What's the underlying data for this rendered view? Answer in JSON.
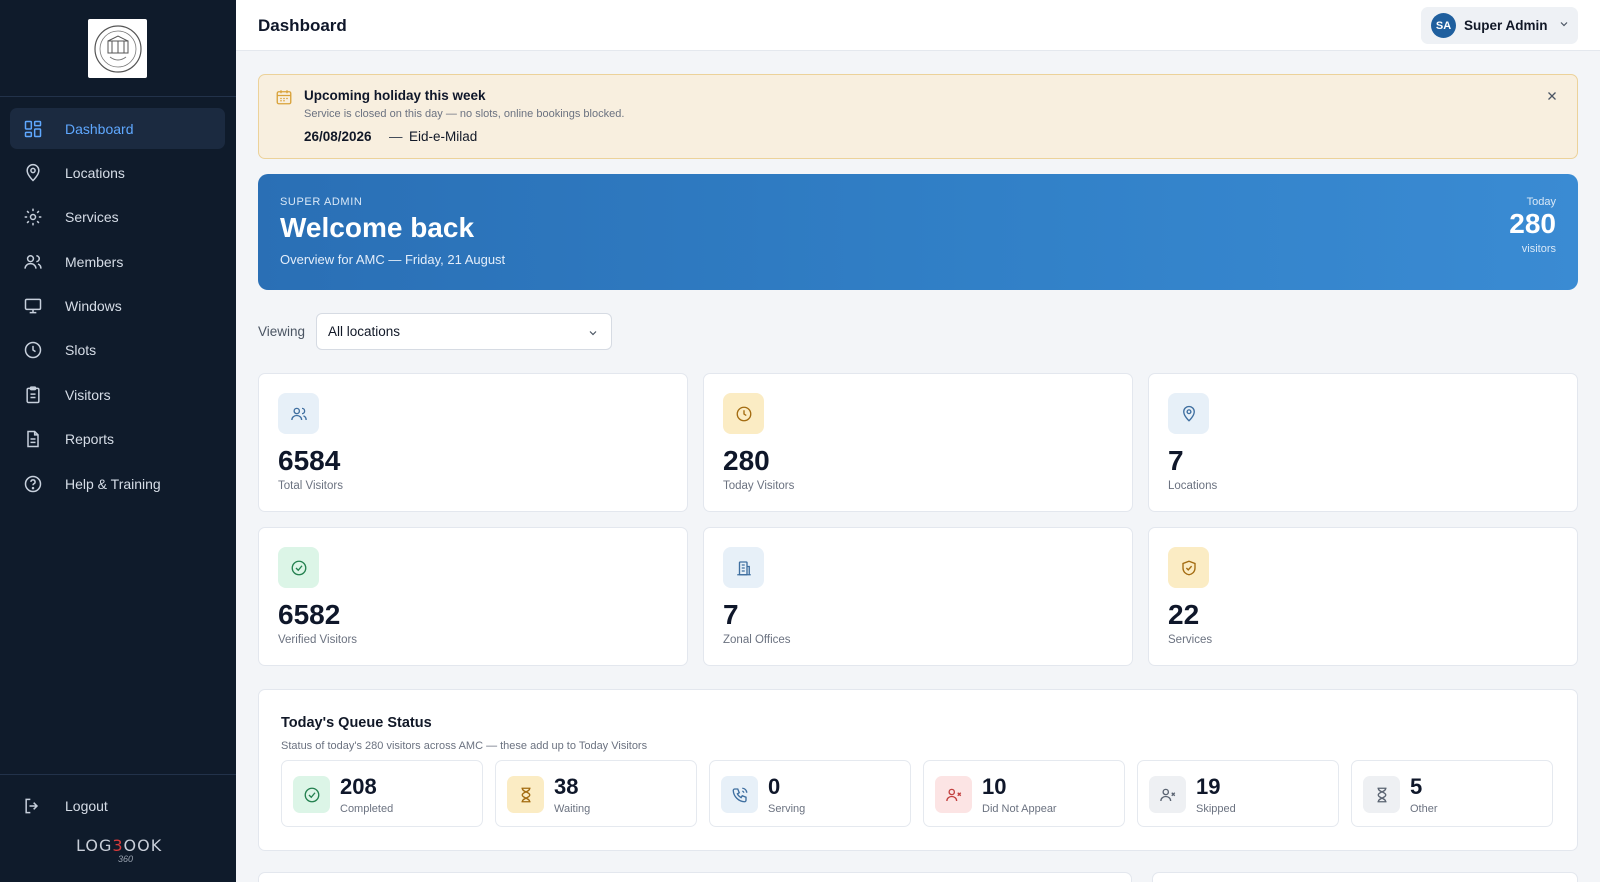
{
  "sidebar": {
    "items": [
      {
        "label": "Dashboard"
      },
      {
        "label": "Locations"
      },
      {
        "label": "Services"
      },
      {
        "label": "Members"
      },
      {
        "label": "Windows"
      },
      {
        "label": "Slots"
      },
      {
        "label": "Visitors"
      },
      {
        "label": "Reports"
      },
      {
        "label": "Help & Training"
      }
    ],
    "logout_label": "Logout",
    "brand": {
      "pre": "LOG",
      "three": "3",
      "post": "OOK",
      "sub": "360"
    }
  },
  "header": {
    "title": "Dashboard",
    "user": {
      "initials": "SA",
      "name": "Super Admin"
    }
  },
  "holiday": {
    "title": "Upcoming holiday this week",
    "subtitle": "Service is closed on this day — no slots, online bookings blocked.",
    "date": "26/08/2026",
    "separator": "—",
    "name": "Eid-e-Milad"
  },
  "hero": {
    "kicker": "SUPER ADMIN",
    "title": "Welcome back",
    "subtitle": "Overview for AMC — Friday, 21 August",
    "right_label": "Today",
    "right_value": "280",
    "right_unit": "visitors"
  },
  "filter": {
    "label": "Viewing",
    "value": "All locations"
  },
  "stats": [
    {
      "value": "6584",
      "label": "Total Visitors"
    },
    {
      "value": "280",
      "label": "Today Visitors"
    },
    {
      "value": "7",
      "label": "Locations"
    },
    {
      "value": "6582",
      "label": "Verified Visitors"
    },
    {
      "value": "7",
      "label": "Zonal Offices"
    },
    {
      "value": "22",
      "label": "Services"
    }
  ],
  "queue": {
    "title": "Today's Queue Status",
    "subtitle": "Status of today's 280 visitors across AMC — these add up to Today Visitors",
    "items": [
      {
        "value": "208",
        "label": "Completed"
      },
      {
        "value": "38",
        "label": "Waiting"
      },
      {
        "value": "0",
        "label": "Serving"
      },
      {
        "value": "10",
        "label": "Did Not Appear"
      },
      {
        "value": "19",
        "label": "Skipped"
      },
      {
        "value": "5",
        "label": "Other"
      }
    ]
  },
  "colors": {
    "sidebar_bg": "#0f1b2b",
    "accent": "#5fa8ff",
    "hero": "#2f7bc2",
    "holiday_bg": "#f8efdf"
  }
}
